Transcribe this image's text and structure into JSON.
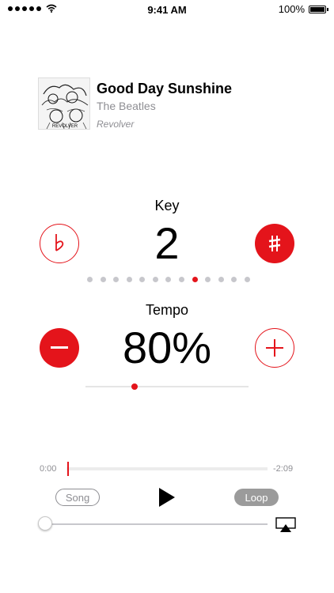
{
  "status_bar": {
    "time": "9:41 AM",
    "battery_text": "100%",
    "signal_dots": 5
  },
  "track": {
    "title": "Good Day Sunshine",
    "artist": "The Beatles",
    "album": "Revolver",
    "artwork_text": "REVOLVER"
  },
  "key": {
    "label": "Key",
    "value": "2",
    "flat_icon": "flat-icon",
    "sharp_icon": "sharp-icon",
    "dot_count": 13,
    "active_dot_index": 8
  },
  "tempo": {
    "label": "Tempo",
    "value": "80%",
    "slider_fraction": 0.3,
    "minus_icon": "minus-icon",
    "plus_icon": "plus-icon"
  },
  "playback": {
    "elapsed": "0:00",
    "remaining": "-2:09",
    "progress_fraction": 0.0,
    "song_button": "Song",
    "loop_button": "Loop",
    "play_icon": "play-icon",
    "volume_fraction": 0.0,
    "airplay_icon": "airplay-icon"
  },
  "colors": {
    "accent": "#e4141b",
    "secondary_text": "#8e8e93"
  }
}
